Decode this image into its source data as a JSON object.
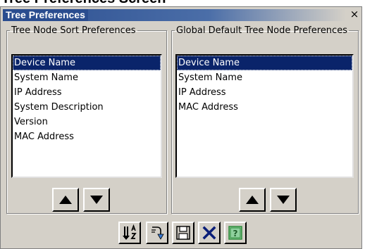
{
  "page_heading": "Tree Preferences Screen",
  "dialog": {
    "title": "Tree Preferences",
    "close_glyph": "×",
    "title_color": "#2a4d8f"
  },
  "sort_group": {
    "legend": "Tree Node Sort Preferences",
    "items": [
      {
        "label": "Device Name",
        "selected": true
      },
      {
        "label": "System Name",
        "selected": false
      },
      {
        "label": "IP Address",
        "selected": false
      },
      {
        "label": "System Description",
        "selected": false
      },
      {
        "label": "Version",
        "selected": false
      },
      {
        "label": "MAC Address",
        "selected": false
      }
    ],
    "move_up_icon": "triangle-up-icon",
    "move_down_icon": "triangle-down-icon"
  },
  "global_group": {
    "legend": "Global Default Tree Node Preferences",
    "items": [
      {
        "label": "Device Name",
        "selected": true
      },
      {
        "label": "System Name",
        "selected": false
      },
      {
        "label": "IP Address",
        "selected": false
      },
      {
        "label": "MAC Address",
        "selected": false
      }
    ],
    "move_up_icon": "triangle-up-icon",
    "move_down_icon": "triangle-down-icon"
  },
  "toolbar": {
    "buttons": [
      {
        "name": "sort-az-button",
        "icon": "sort-az-icon"
      },
      {
        "name": "apply-default-button",
        "icon": "arrow-redirect-icon"
      },
      {
        "name": "save-button",
        "icon": "floppy-disk-icon"
      },
      {
        "name": "cancel-button",
        "icon": "close-x-icon",
        "color": "#0a1e78"
      },
      {
        "name": "help-button",
        "icon": "help-question-icon",
        "color": "#2e8b3a"
      }
    ]
  },
  "colors": {
    "selection": "#0a246a",
    "dialog_background": "#d4d0c8"
  }
}
